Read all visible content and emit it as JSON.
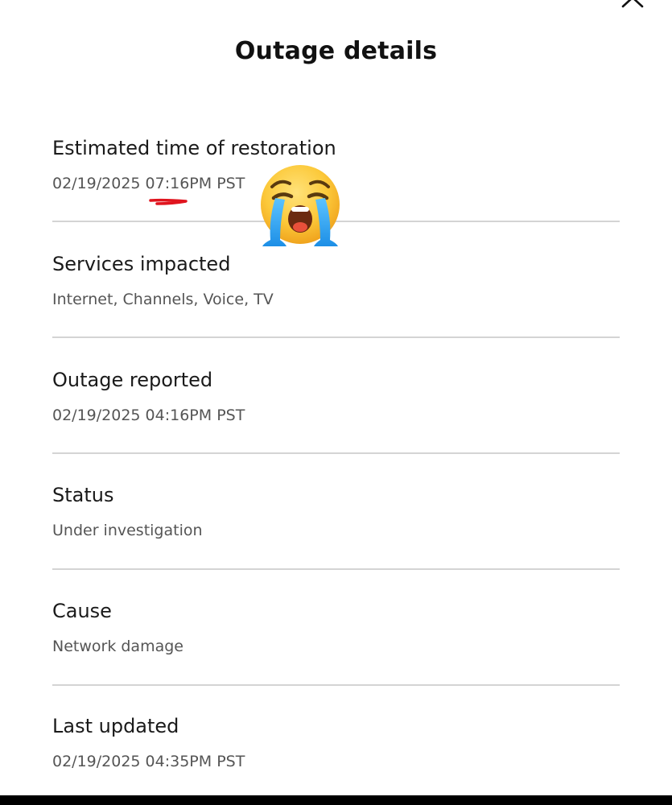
{
  "header": {
    "title": "Outage details",
    "close_icon": "close-icon"
  },
  "details": [
    {
      "label": "Estimated time of restoration",
      "value": "02/19/2025 07:16PM PST"
    },
    {
      "label": "Services impacted",
      "value": "Internet, Channels, Voice, TV"
    },
    {
      "label": "Outage reported",
      "value": "02/19/2025 04:16PM PST"
    },
    {
      "label": "Status",
      "value": "Under investigation"
    },
    {
      "label": "Cause",
      "value": "Network damage"
    },
    {
      "label": "Last updated",
      "value": "02/19/2025 04:35PM PST"
    }
  ],
  "annotations": {
    "emoji_icon": "loudly-crying-face-icon",
    "underline_color": "#e0141e"
  },
  "colors": {
    "text_primary": "#111111",
    "text_secondary": "#555555",
    "divider": "#d4d4d4"
  }
}
